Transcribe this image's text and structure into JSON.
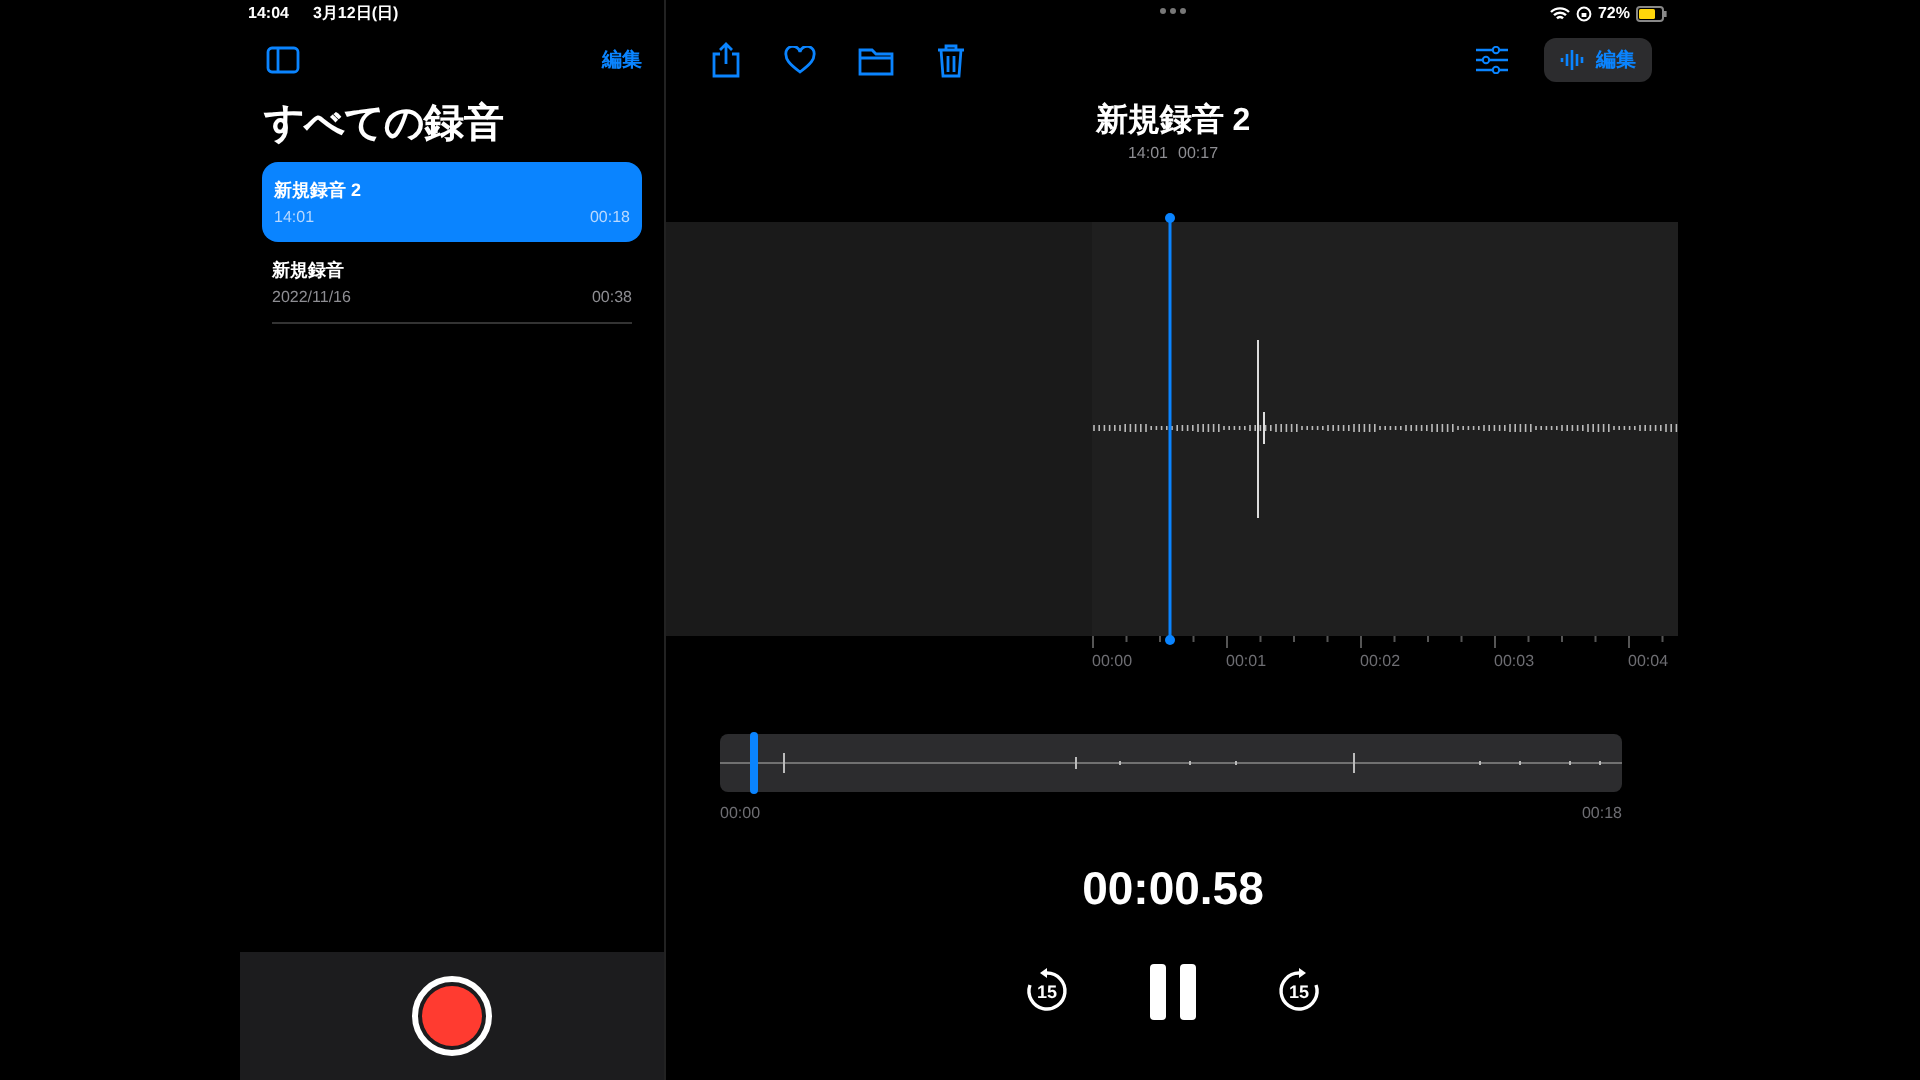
{
  "status_bar": {
    "time": "14:04",
    "date": "3月12日(日)",
    "battery": "72%"
  },
  "sidebar": {
    "edit": "編集",
    "title": "すべての録音",
    "recordings": [
      {
        "name": "新規録音 2",
        "date": "14:01",
        "duration": "00:18",
        "selected": true
      },
      {
        "name": "新規録音",
        "date": "2022/11/16",
        "duration": "00:38",
        "selected": false
      }
    ]
  },
  "detail": {
    "edit": "編集",
    "title": "新規録音 2",
    "time": "14:01",
    "duration": "00:17",
    "ruler": [
      "00:00",
      "00:01",
      "00:02",
      "00:03",
      "00:04"
    ],
    "overview": {
      "start": "00:00",
      "end": "00:18",
      "level": 0.03
    },
    "elapsed": "00:00.58",
    "skip_back": "15",
    "skip_forward": "15"
  }
}
